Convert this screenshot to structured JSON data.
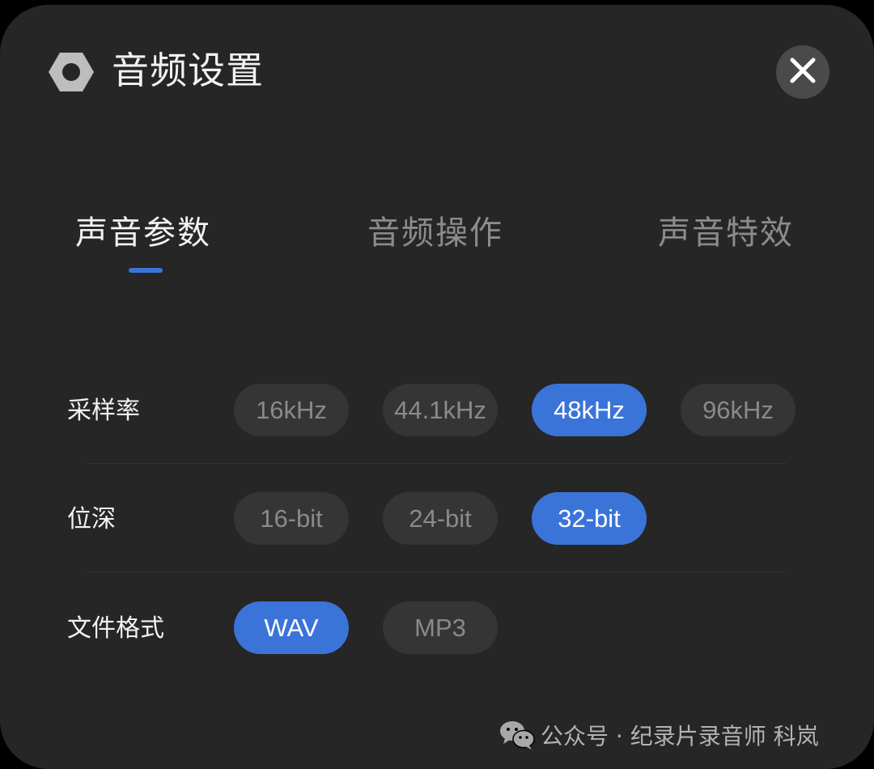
{
  "dialog": {
    "title": "音频设置",
    "title_icon": "hex-nut-icon",
    "close_icon": "close-icon"
  },
  "tabs": [
    {
      "label": "声音参数",
      "active": true
    },
    {
      "label": "音频操作",
      "active": false
    },
    {
      "label": "声音特效",
      "active": false
    }
  ],
  "settings": {
    "sample_rate": {
      "label": "采样率",
      "options": [
        "16kHz",
        "44.1kHz",
        "48kHz",
        "96kHz"
      ],
      "selected": "48kHz"
    },
    "bit_depth": {
      "label": "位深",
      "options": [
        "16-bit",
        "24-bit",
        "32-bit"
      ],
      "selected": "32-bit"
    },
    "file_format": {
      "label": "文件格式",
      "options": [
        "WAV",
        "MP3"
      ],
      "selected": "WAV"
    }
  },
  "watermark": {
    "icon": "wechat-icon",
    "text": "公众号 · 纪录片录音师 科岚"
  },
  "colors": {
    "accent": "#3b74d8",
    "panel_bg": "#262626",
    "chip_bg": "#353535"
  }
}
